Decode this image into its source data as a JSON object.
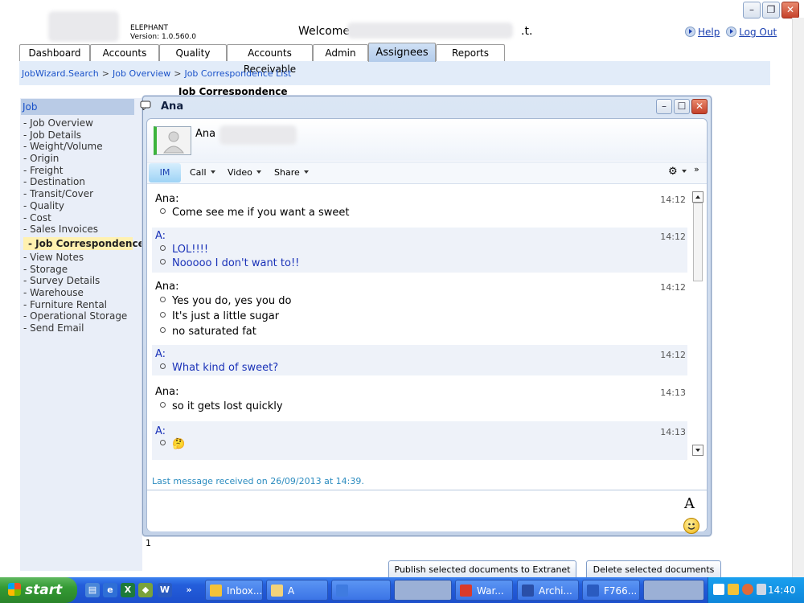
{
  "app": {
    "brand_name": "ELEPHANT",
    "version": "Version: 1.0.560.0",
    "welcome": "Welcome",
    "welcome_suffix": ".t.",
    "help": "Help",
    "logout": "Log Out"
  },
  "tabs": [
    {
      "label": "Dashboard"
    },
    {
      "label": "Accounts"
    },
    {
      "label": "Quality"
    },
    {
      "label": "Accounts Receivable"
    },
    {
      "label": "Admin"
    },
    {
      "label": "Assignees",
      "active": true
    },
    {
      "label": "Reports"
    }
  ],
  "breadcrumb": [
    "JobWizard.Search",
    "Job Overview",
    "Job Correspondence List"
  ],
  "breadcrumb_sep": ">",
  "page_heading": "Job Correspondence",
  "sidebar": {
    "heading": "Job",
    "items": [
      "- Job Overview",
      "- Job Details",
      "- Weight/Volume",
      "- Origin",
      "- Freight",
      "- Destination",
      "- Transit/Cover",
      "- Quality",
      "- Cost",
      "- Sales Invoices",
      "- Job Correspondence",
      "- View Notes",
      "- Storage",
      "- Survey Details",
      "- Warehouse",
      "- Furniture Rental",
      "- Operational Storage",
      "- Send Email"
    ],
    "active_index": 10
  },
  "page_number": "1",
  "buttons": {
    "publish": "Publish selected documents to Extranet",
    "delete": "Delete selected documents"
  },
  "im": {
    "window_title": "Ana",
    "contact_name": "Ana",
    "toolbar": {
      "im": "IM",
      "call": "Call",
      "video": "Video",
      "share": "Share",
      "more": "»"
    },
    "messages": [
      {
        "sender": "Ana:",
        "time": "14:12",
        "me": false,
        "lines": [
          "Come see me if you want a sweet"
        ]
      },
      {
        "sender": "A:",
        "time": "14:12",
        "me": true,
        "lines": [
          "LOL!!!!",
          "Nooooo I don't want to!!"
        ]
      },
      {
        "sender": "Ana:",
        "time": "14:12",
        "me": false,
        "lines": [
          "Yes you do, yes you do",
          "It's just a little sugar",
          "no saturated fat"
        ]
      },
      {
        "sender": "A:",
        "time": "14:12",
        "me": true,
        "lines": [
          "What kind of sweet?"
        ]
      },
      {
        "sender": "Ana:",
        "time": "14:13",
        "me": false,
        "lines": [
          "so it gets lost quickly"
        ]
      },
      {
        "sender": "A:",
        "time": "14:13",
        "me": true,
        "lines": [
          "🤔"
        ]
      }
    ],
    "last_received": "Last message received on 26/09/2013 at 14:39.",
    "font_button": "A"
  },
  "taskbar": {
    "start": "start",
    "tasks": [
      "Inbox...",
      "A",
      "",
      "",
      "War...",
      "Archi...",
      "F766..."
    ],
    "clock": "14:40"
  },
  "colors": {
    "link": "#1a52c9",
    "self_message": "#1a32b8",
    "active_sidebar": "#fff1b0",
    "taskbar": "#245edb"
  }
}
